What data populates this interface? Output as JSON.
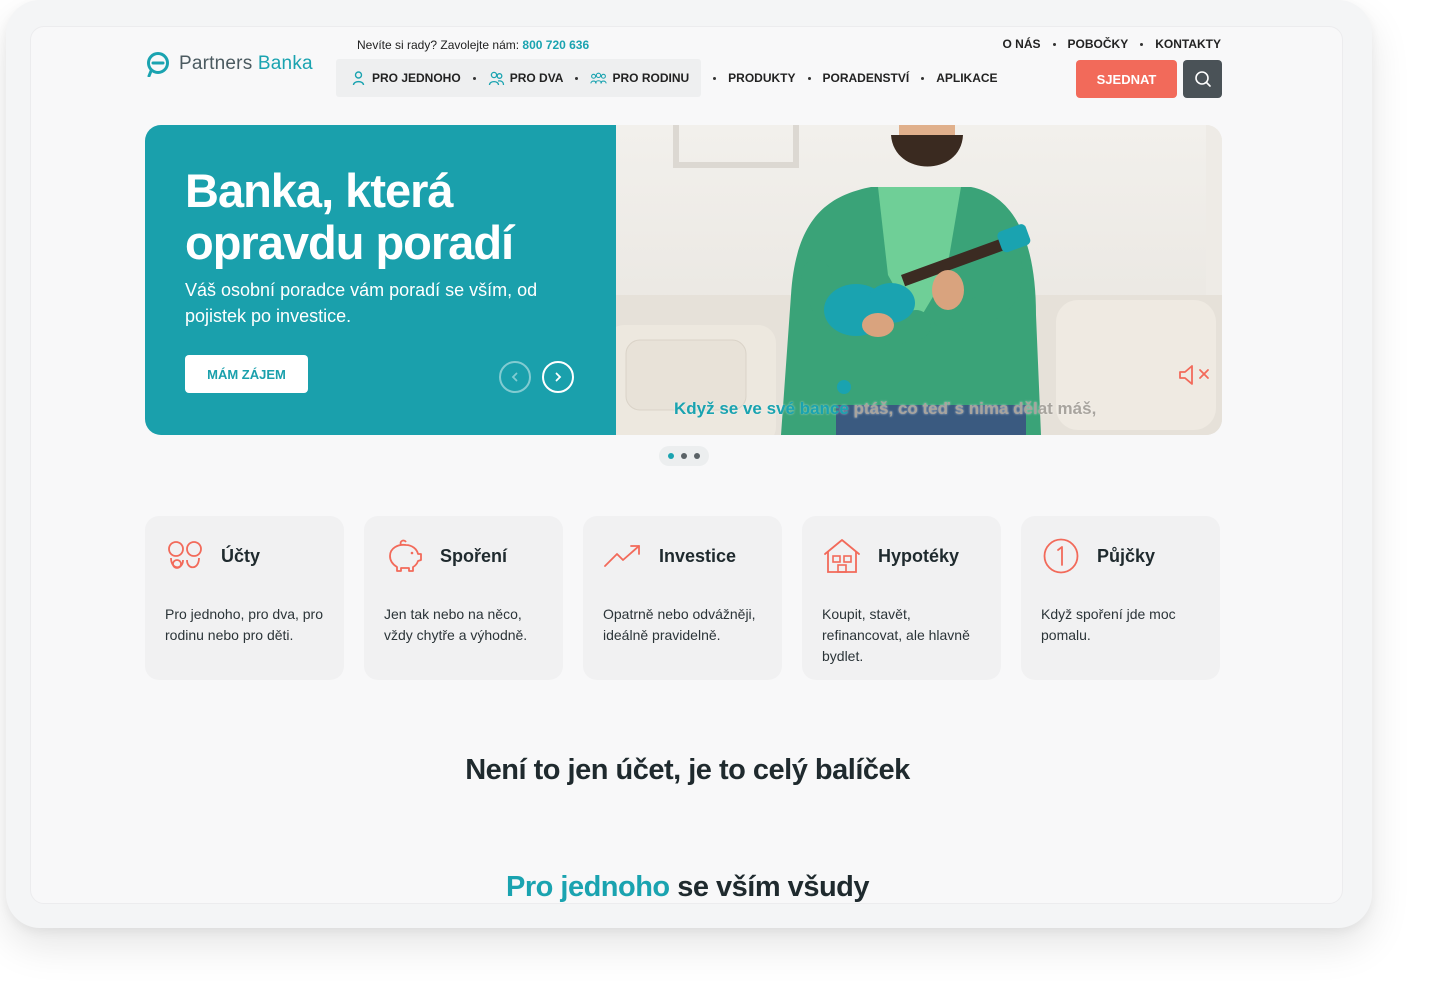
{
  "brand": {
    "name_part1": "Partners",
    "name_part2": "Banka"
  },
  "hotline": {
    "text": "Nevíte si rady? Zavolejte nám:",
    "number": "800 720 636"
  },
  "top_links": [
    "O NÁS",
    "POBOČKY",
    "KONTAKTY"
  ],
  "nav": {
    "segments": [
      "PRO JEDNOHO",
      "PRO DVA",
      "PRO RODINU"
    ],
    "items": [
      "PRODUKTY",
      "PORADENSTVÍ",
      "APLIKACE"
    ]
  },
  "header_actions": {
    "cta_label": "SJEDNAT",
    "search_icon": "search-icon"
  },
  "hero": {
    "title": "Banka, která opravdu poradí",
    "subtitle": "Váš osobní poradce vám poradí se vším, od pojistek po investice.",
    "cta_label": "MÁM ZÁJEM",
    "caption_highlight": "Když se ve své bance",
    "caption_rest": " ptáš, co teď s nima dělat máš,",
    "slides_count": 3,
    "active_slide": 1
  },
  "cards": [
    {
      "title": "Účty",
      "text": "Pro jednoho, pro dva, pro rodinu nebo pro děti.",
      "icon": "accounts-icon"
    },
    {
      "title": "Spoření",
      "text": "Jen tak nebo na něco, vždy chytře a výhodně.",
      "icon": "piggy-bank-icon"
    },
    {
      "title": "Investice",
      "text": "Opatrně nebo odvážněji, ideálně pravidelně.",
      "icon": "trend-up-icon"
    },
    {
      "title": "Hypotéky",
      "text": "Koupit, stavět, refinancovat, ale hlavně bydlet.",
      "icon": "house-icon"
    },
    {
      "title": "Půjčky",
      "text": "Když spoření jde moc pomalu.",
      "icon": "loan-icon"
    }
  ],
  "section": {
    "title": "Není to jen účet, je to celý balíček",
    "sub_highlight": "Pro jednoho",
    "sub_rest": " se vším všudy"
  },
  "colors": {
    "accent": "#1aa3b0",
    "cta": "#f26a5a",
    "icon": "#f26a5a"
  }
}
